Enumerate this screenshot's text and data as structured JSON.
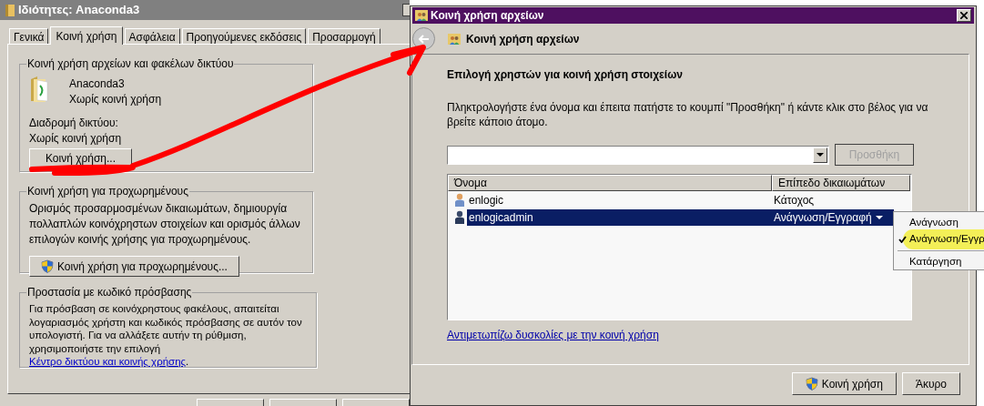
{
  "properties_window": {
    "title": "Ιδιότητες: Anaconda3",
    "tabs": [
      {
        "label": "Γενικά",
        "selected": false
      },
      {
        "label": "Κοινή χρήση",
        "selected": true
      },
      {
        "label": "Ασφάλεια",
        "selected": false
      },
      {
        "label": "Προηγούμενες εκδόσεις",
        "selected": false
      },
      {
        "label": "Προσαρμογή",
        "selected": false
      }
    ],
    "network_sharing": {
      "legend": "Κοινή χρήση αρχείων και φακέλων δικτύου",
      "folder_name": "Anaconda3",
      "folder_status": "Χωρίς κοινή χρήση",
      "path_label": "Διαδρομή δικτύου:",
      "path_value": "Χωρίς κοινή χρήση",
      "button": "Κοινή χρήση..."
    },
    "advanced_sharing": {
      "legend": "Κοινή χρήση για προχωρημένους",
      "description": "Ορισμός προσαρμοσμένων δικαιωμάτων, δημιουργία πολλαπλών κοινόχρηστων στοιχείων και ορισμός άλλων επιλογών κοινής χρήσης για προχωρημένους.",
      "button": "Κοινή χρήση για προχωρημένους..."
    },
    "password_protection": {
      "legend": "Προστασία με κωδικό πρόσβασης",
      "text": "Για πρόσβαση σε κοινόχρηστους φακέλους, απαιτείται λογαριασμός χρήστη και κωδικός πρόσβασης σε αυτόν τον υπολογιστή. Για να αλλάξετε αυτήν τη ρύθμιση, χρησιμοποιήστε την επιλογή",
      "link": "Κέντρο δικτύου και κοινής χρήσης",
      "text_end": "."
    }
  },
  "share_dialog": {
    "title": "Κοινή χρήση αρχείων",
    "header": "Κοινή χρήση αρχείων",
    "heading": "Επιλογή χρηστών για κοινή χρήση στοιχείων",
    "instructions": "Πληκτρολογήστε ένα όνομα και έπειτα πατήστε το κουμπί \"Προσθήκη\" ή κάντε κλικ στο βέλος για να βρείτε κάποιο άτομο.",
    "add_button": {
      "label": "Προσθήκη",
      "disabled": true
    },
    "table": {
      "columns": [
        "Όνομα",
        "Επίπεδο δικαιωμάτων"
      ],
      "rows": [
        {
          "name": "enlogic",
          "permission": "Κάτοχος",
          "selected": false
        },
        {
          "name": "enlogicadmin",
          "permission": "Ανάγνωση/Εγγραφή",
          "selected": true
        }
      ]
    },
    "permission_menu": {
      "items": [
        {
          "label": "Ανάγνωση",
          "checked": false,
          "separated": false
        },
        {
          "label": "Ανάγνωση/Εγγρ",
          "checked": true,
          "separated": false
        },
        {
          "label": "Κατάργηση",
          "checked": false,
          "separated": true
        }
      ]
    },
    "help_link": "Αντιμετωπίζω δυσκολίες με την κοινή χρήση",
    "buttons": [
      {
        "label": "Κοινή χρήση",
        "shield": true
      },
      {
        "label": "Άκυρο",
        "shield": false
      }
    ]
  }
}
